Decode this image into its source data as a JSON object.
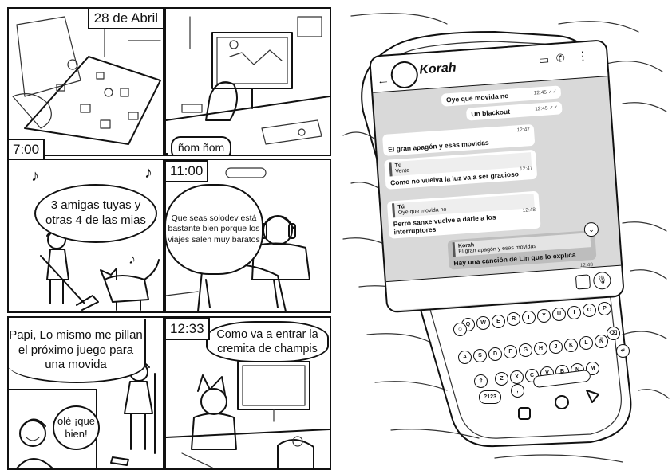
{
  "comic": {
    "panels": [
      {
        "caption": "28 de Abril"
      },
      {
        "caption": "7:00",
        "speech": "ñom ñom"
      },
      {
        "speech": "3 amigas tuyas y otras 4 de las mias"
      },
      {
        "caption": "11:00",
        "speech": "Que seas solodev está bastante bien porque los viajes salen muy baratos"
      },
      {
        "speech": "Papi, Lo mismo me pillan el próximo juego para una movida",
        "reply": "olé ¡que bien!"
      },
      {
        "caption": "12:33",
        "speech": "Como va a entrar la cremita de champis"
      }
    ]
  },
  "phone": {
    "contact_name": "Korah",
    "messages": [
      {
        "side": "out",
        "text": "Oye que movida no",
        "time": "12:45 ✓✓"
      },
      {
        "side": "out",
        "text": "Un blackout",
        "time": "12:45 ✓✓"
      },
      {
        "side": "in",
        "text": "El gran apagón y esas movidas",
        "time": "12:47"
      },
      {
        "side": "in",
        "quote_author": "Tú",
        "quote_text": "Vente",
        "text": "Como no vuelva la luz va a ser gracioso",
        "time": "12:47"
      },
      {
        "side": "in",
        "quote_author": "Tú",
        "quote_text": "Oye que movida no",
        "text": "Perro sanxe vuelve a darle a los interruptores",
        "time": "12:48"
      },
      {
        "side": "out",
        "quote_author": "Korah",
        "quote_text": "El gran apagón y esas movidas",
        "text": "Hay una canción de Lin que lo explica",
        "time": "12:48"
      }
    ],
    "keyboard": {
      "row1": [
        "Q",
        "W",
        "E",
        "R",
        "T",
        "Y",
        "U",
        "I",
        "O",
        "P"
      ],
      "row2": [
        "A",
        "S",
        "D",
        "F",
        "G",
        "H",
        "J",
        "K",
        "L",
        "Ñ"
      ],
      "row3": [
        "Z",
        "X",
        "C",
        "V",
        "B",
        "N",
        "M"
      ],
      "special": [
        "?123",
        ","
      ]
    }
  }
}
